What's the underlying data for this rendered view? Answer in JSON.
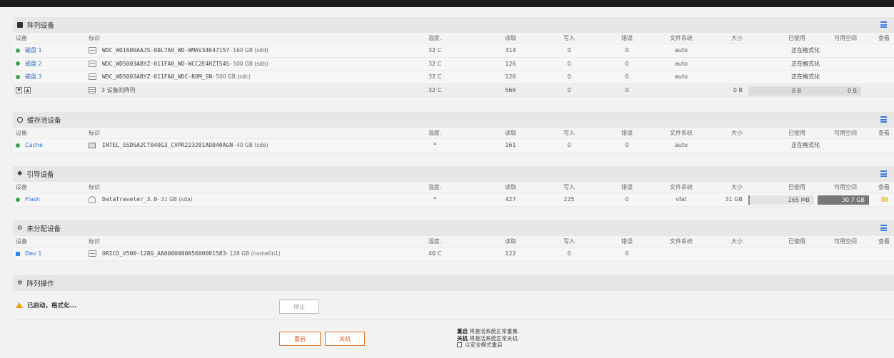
{
  "columns": {
    "device": "设备",
    "identification": "标识",
    "temp": "温度.",
    "reads": "读取",
    "writes": "写入",
    "errors": "错误",
    "fs": "文件系统",
    "size": "大小",
    "used": "已使用",
    "free": "可用空间",
    "view": "查看"
  },
  "array": {
    "title": "阵列设备",
    "rows": [
      {
        "dev": "磁盘 1",
        "id": "WDC_WD1600AAJS-00L7A0_WD-WMAV34647157",
        "info": " - 160 GB (sdd)",
        "temp": "32 C",
        "reads": "314",
        "writes": "0",
        "errors": "0",
        "fs": "auto",
        "status": "正在格式化"
      },
      {
        "dev": "磁盘 2",
        "id": "WDC_WD5003ABYZ-011FA0_WD-WCC2E4HZT54S",
        "info": " - 500 GB (sdb)",
        "temp": "32 C",
        "reads": "126",
        "writes": "0",
        "errors": "0",
        "fs": "auto",
        "status": "正在格式化"
      },
      {
        "dev": "磁盘 3",
        "id": "WDC_WD5003ABYZ-011FA0_WDC-ROM_SN",
        "info": " - 500 GB (sdc)",
        "temp": "32 C",
        "reads": "126",
        "writes": "0",
        "errors": "0",
        "fs": "auto",
        "status": "正在格式化"
      }
    ],
    "summary": {
      "label": "3 设备的阵列",
      "temp": "32 C",
      "reads": "566",
      "writes": "0",
      "errors": "0",
      "size": "0 B",
      "used": "0 B",
      "free": "0 B"
    }
  },
  "cache": {
    "title": "缓存池设备",
    "rows": [
      {
        "dev": "Cache",
        "id": "INTEL_SSDSA2CT040G3_CVPR223201AU040AGN",
        "info": " - 40 GB (sde)",
        "temp": "*",
        "reads": "161",
        "writes": "0",
        "errors": "0",
        "fs": "auto",
        "status": "正在格式化"
      }
    ]
  },
  "boot": {
    "title": "引导设备",
    "rows": [
      {
        "dev": "Flash",
        "id": "DataTraveler_3.0",
        "info": " - 31 GB (sda)",
        "temp": "*",
        "reads": "427",
        "writes": "225",
        "errors": "0",
        "fs": "vfat",
        "size": "31 GB",
        "used": "265 MB",
        "free": "30.7 GB"
      }
    ]
  },
  "unassigned": {
    "title": "未分配设备",
    "rows": [
      {
        "dev": "Dev 1",
        "id": "ORICO_V500-128G_AA000000005600001583",
        "info": " - 128 GB (nvme0n1)",
        "temp": "40 C",
        "reads": "122",
        "writes": "0",
        "errors": "0"
      }
    ]
  },
  "operations": {
    "title": "阵列操作",
    "status": "已启动，格式化...",
    "stop_label": "停止",
    "reboot_label": "重启",
    "shutdown_label": "关机",
    "note_reboot_bold": "重启",
    "note_reboot_text": " 将激活系统正常重置.",
    "note_shutdown_bold": "关机",
    "note_shutdown_text": " 将激活系统正常关机.",
    "safe_mode_label": "以安全模式重启"
  },
  "colors": {
    "accent": "#2a6ed2",
    "online": "#3aa64d",
    "warning": "#f0a000",
    "danger": "#e05a20"
  }
}
